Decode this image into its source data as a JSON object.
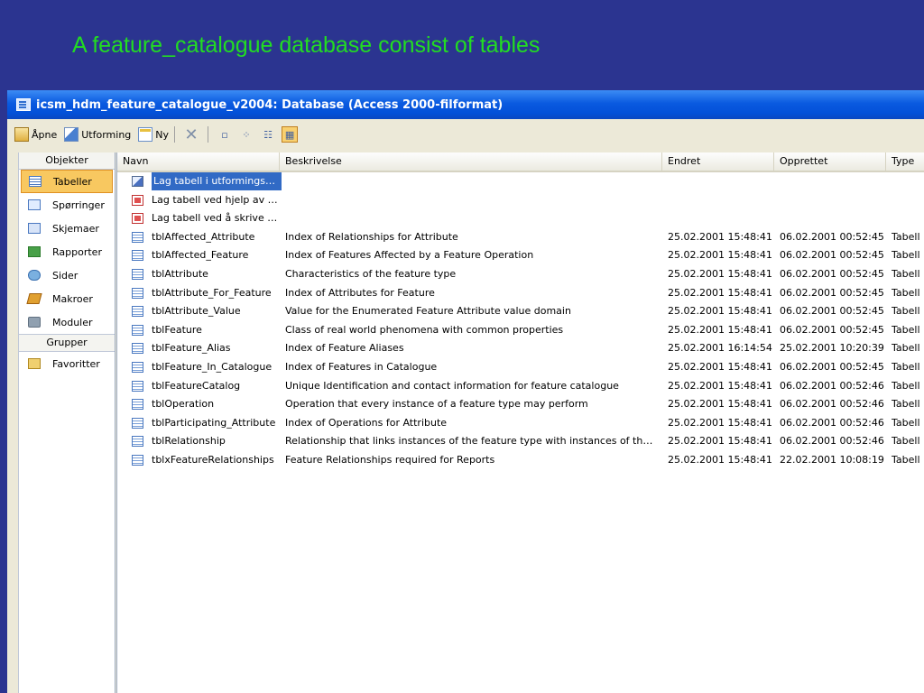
{
  "slide": {
    "title": "A feature_catalogue database consist of tables"
  },
  "window": {
    "title": "icsm_hdm_feature_catalogue_v2004: Database (Access 2000-filformat)"
  },
  "toolbar": {
    "open_label": "Åpne",
    "design_label": "Utforming",
    "new_label": "Ny"
  },
  "navigation": {
    "objects_header": "Objekter",
    "objects": [
      {
        "label": "Tabeller",
        "icon": "table-icon",
        "selected": true
      },
      {
        "label": "Spørringer",
        "icon": "query-icon"
      },
      {
        "label": "Skjemaer",
        "icon": "form-icon"
      },
      {
        "label": "Rapporter",
        "icon": "report-icon"
      },
      {
        "label": "Sider",
        "icon": "page-icon"
      },
      {
        "label": "Makroer",
        "icon": "macro-icon"
      },
      {
        "label": "Moduler",
        "icon": "module-icon"
      }
    ],
    "groups_header": "Grupper",
    "groups": [
      {
        "label": "Favoritter",
        "icon": "favorites-folder-icon"
      }
    ]
  },
  "list": {
    "columns": [
      "Navn",
      "Beskrivelse",
      "Endret",
      "Opprettet",
      "Type"
    ],
    "rows": [
      {
        "icon": "design-view-icon",
        "name": "Lag tabell i utformingsvis…",
        "description": "",
        "modified": "",
        "created": "",
        "type": "",
        "selected": true
      },
      {
        "icon": "wizard-icon",
        "name": "Lag tabell ved hjelp av ve…",
        "description": "",
        "modified": "",
        "created": "",
        "type": ""
      },
      {
        "icon": "wizard-icon",
        "name": "Lag tabell ved å skrive in…",
        "description": "",
        "modified": "",
        "created": "",
        "type": ""
      },
      {
        "icon": "table-icon",
        "name": "tblAffected_Attribute",
        "description": "Index of Relationships for Attribute",
        "modified": "25.02.2001 15:48:41",
        "created": "06.02.2001 00:52:45",
        "type": "Tabell"
      },
      {
        "icon": "table-icon",
        "name": "tblAffected_Feature",
        "description": "Index of Features Affected by a Feature Operation",
        "modified": "25.02.2001 15:48:41",
        "created": "06.02.2001 00:52:45",
        "type": "Tabell"
      },
      {
        "icon": "table-icon",
        "name": "tblAttribute",
        "description": "Characteristics of the feature type",
        "modified": "25.02.2001 15:48:41",
        "created": "06.02.2001 00:52:45",
        "type": "Tabell"
      },
      {
        "icon": "table-icon",
        "name": "tblAttribute_For_Feature",
        "description": "Index of Attributes for Feature",
        "modified": "25.02.2001 15:48:41",
        "created": "06.02.2001 00:52:45",
        "type": "Tabell"
      },
      {
        "icon": "table-icon",
        "name": "tblAttribute_Value",
        "description": "Value for the Enumerated Feature Attribute value domain",
        "modified": "25.02.2001 15:48:41",
        "created": "06.02.2001 00:52:45",
        "type": "Tabell"
      },
      {
        "icon": "table-icon",
        "name": "tblFeature",
        "description": "Class of real world phenomena with common properties",
        "modified": "25.02.2001 15:48:41",
        "created": "06.02.2001 00:52:45",
        "type": "Tabell"
      },
      {
        "icon": "table-icon",
        "name": "tblFeature_Alias",
        "description": "Index of Feature Aliases",
        "modified": "25.02.2001 16:14:54",
        "created": "25.02.2001 10:20:39",
        "type": "Tabell"
      },
      {
        "icon": "table-icon",
        "name": "tblFeature_In_Catalogue",
        "description": "Index of Features in Catalogue",
        "modified": "25.02.2001 15:48:41",
        "created": "06.02.2001 00:52:45",
        "type": "Tabell"
      },
      {
        "icon": "table-icon",
        "name": "tblFeatureCatalog",
        "description": "Unique Identification and contact information for feature catalogue",
        "modified": "25.02.2001 15:48:41",
        "created": "06.02.2001 00:52:46",
        "type": "Tabell"
      },
      {
        "icon": "table-icon",
        "name": "tblOperation",
        "description": "Operation that every instance of a feature type may perform",
        "modified": "25.02.2001 15:48:41",
        "created": "06.02.2001 00:52:46",
        "type": "Tabell"
      },
      {
        "icon": "table-icon",
        "name": "tblParticipating_Attribute",
        "description": "Index of Operations for Attribute",
        "modified": "25.02.2001 15:48:41",
        "created": "06.02.2001 00:52:46",
        "type": "Tabell"
      },
      {
        "icon": "table-icon",
        "name": "tblRelationship",
        "description": "Relationship that links instances of the feature type with instances of the same …",
        "modified": "25.02.2001 15:48:41",
        "created": "06.02.2001 00:52:46",
        "type": "Tabell"
      },
      {
        "icon": "table-icon",
        "name": "tblxFeatureRelationships",
        "description": "Feature Relationships required for Reports",
        "modified": "25.02.2001 15:48:41",
        "created": "22.02.2001 10:08:19",
        "type": "Tabell"
      }
    ]
  }
}
